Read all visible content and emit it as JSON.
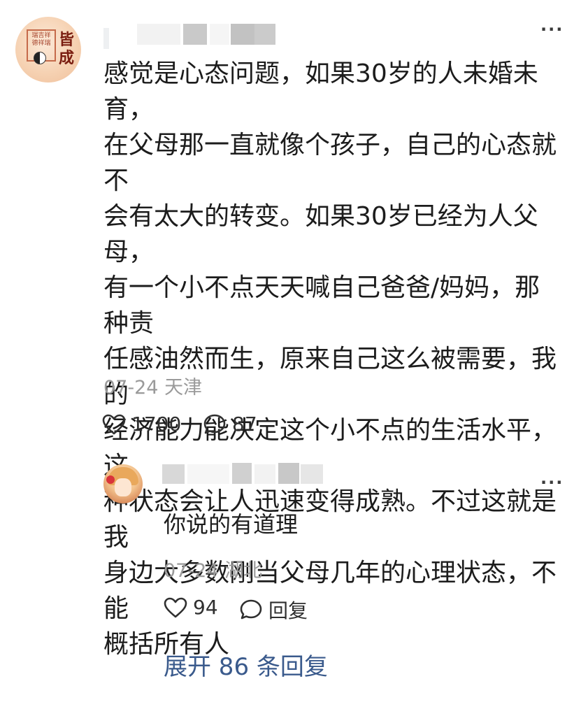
{
  "top_comment": {
    "text": "感觉是心态问题，如果30岁的人未婚未育，\n在父母那一直就像个孩子，自己的心态就不\n会有太大的转变。如果30岁已经为人父母，\n有一个小不点天天喊自己爸爸/妈妈，那种责\n任感油然而生，原来自己这么被需要，我的\n经济能力能决定这个小不点的生活水平，这\n种状态会让人迅速变得成熟。不过这就是我\n身边大多数刚当父母几年的心理状态，不能\n概括所有人",
    "date": "07-24",
    "location": "天津",
    "likes": "1700",
    "comments": "87",
    "avatar_text": {
      "seal": "瑞吉祥\n德祥瑞",
      "brush": "皆成"
    }
  },
  "reply": {
    "text": "你说的有道理",
    "date": "07-24",
    "location": "湖北",
    "likes": "94",
    "reply_label": "回复"
  },
  "more_label": "···",
  "expand_label": "展开 86 条回复",
  "icons": {
    "more": "more-horizontal-icon",
    "like": "heart-outline-icon",
    "comment": "speech-bubble-icon"
  },
  "colors": {
    "text": "#1c1c1c",
    "meta": "#9a9a9a",
    "link": "#3a5a8c"
  }
}
